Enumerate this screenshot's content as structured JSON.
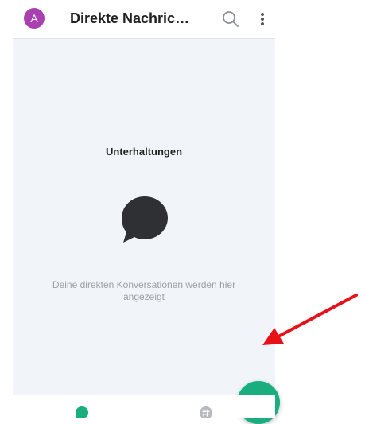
{
  "header": {
    "avatar_letter": "A",
    "title": "Direkte Nachric…",
    "search_icon": "search-icon",
    "more_icon": "more-vertical-icon"
  },
  "empty_state": {
    "title": "Unterhaltungen",
    "icon": "chat-bubble-icon",
    "description": "Deine direkten Konversationen werden hier angezeigt"
  },
  "fab": {
    "icon": "new-message-icon"
  },
  "bottom_nav": {
    "items": [
      {
        "icon": "chat-bubble-icon",
        "active": true
      },
      {
        "icon": "hashtag-icon",
        "active": false
      }
    ]
  },
  "colors": {
    "avatar": "#a93fb0",
    "accent": "#1aae7e",
    "annotation_arrow": "#e8111a"
  }
}
